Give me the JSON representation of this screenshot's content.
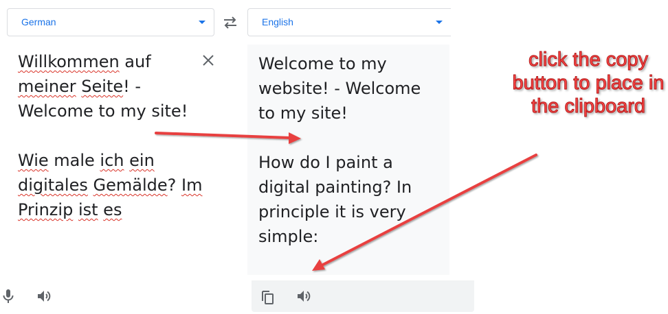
{
  "source": {
    "language": "German",
    "paragraphs": [
      [
        {
          "t": "Willkommen",
          "spell": true
        },
        {
          "t": " auf ",
          "spell": false
        },
        {
          "t": "meiner",
          "spell": true
        },
        {
          "t": " ",
          "spell": false
        },
        {
          "t": "Seite",
          "spell": true
        },
        {
          "t": "! - Welcome to my site!",
          "spell": false
        }
      ],
      [
        {
          "t": "Wie",
          "spell": true
        },
        {
          "t": " male ",
          "spell": false
        },
        {
          "t": "ich",
          "spell": true
        },
        {
          "t": " ",
          "spell": false
        },
        {
          "t": "ein",
          "spell": true
        },
        {
          "t": " ",
          "spell": false
        },
        {
          "t": "digitales",
          "spell": true
        },
        {
          "t": " ",
          "spell": false
        },
        {
          "t": "Gemälde",
          "spell": true
        },
        {
          "t": "? ",
          "spell": false
        },
        {
          "t": "Im",
          "spell": true
        },
        {
          "t": " ",
          "spell": false
        },
        {
          "t": "Prinzip",
          "spell": true
        },
        {
          "t": " ",
          "spell": false
        },
        {
          "t": "ist",
          "spell": true
        },
        {
          "t": " ",
          "spell": false
        },
        {
          "t": "es",
          "spell": true
        }
      ]
    ]
  },
  "target": {
    "language": "English",
    "paragraphs": [
      "Welcome to my website! - Welcome to my site!",
      "How do I paint a digital painting? In principle it is very simple:"
    ]
  },
  "annotation": {
    "text": "click the copy button to place in the clipboard",
    "color": "#ff4a4a"
  },
  "colors": {
    "accent": "#1a73e8",
    "icon": "#5f6368",
    "arrow": "#e8403f"
  },
  "icons": {
    "swap": "swap-arrows-icon",
    "clear": "close-icon",
    "mic": "microphone-icon",
    "speaker": "speaker-icon",
    "copy": "copy-icon"
  }
}
